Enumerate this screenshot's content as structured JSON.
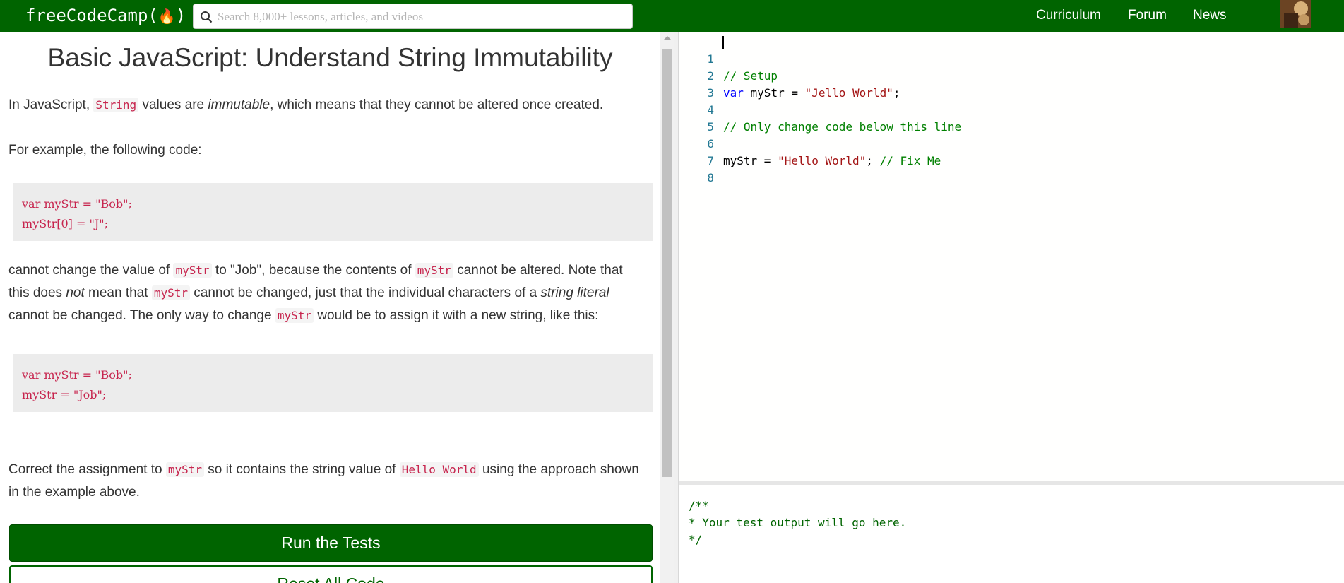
{
  "navbar": {
    "logo_text": "freeCodeCamp(",
    "logo_flame": "🔥",
    "logo_close": ")",
    "search_placeholder": "Search 8,000+ lessons, articles, and videos",
    "links": [
      "Curriculum",
      "Forum",
      "News"
    ]
  },
  "lesson": {
    "title": "Basic JavaScript: Understand String Immutability",
    "p1": {
      "a": "In JavaScript, ",
      "code": "String",
      "b": " values are ",
      "em": "immutable",
      "c": ", which means that they cannot be altered once created."
    },
    "p2": "For example, the following code:",
    "code_block_1": "var myStr = \"Bob\";\nmyStr[0] = \"J\";",
    "p3": {
      "a": "cannot change the value of ",
      "code1": "myStr",
      "b": " to \"Job\", because the contents of ",
      "code2": "myStr",
      "c": " cannot be altered. Note that this does ",
      "em1": "not",
      "d": " mean that ",
      "code3": "myStr",
      "e": " cannot be changed, just that the individual characters of a ",
      "em2": "string literal",
      "f": " cannot be changed. The only way to change ",
      "code4": "myStr",
      "g": " would be to assign it with a new string, like this:"
    },
    "code_block_2": "var myStr = \"Bob\";\nmyStr = \"Job\";",
    "p4": {
      "a": "Correct the assignment to ",
      "code1": "myStr",
      "b": " so it contains the string value of ",
      "code2": "Hello World",
      "c": " using the approach shown in the example above."
    },
    "run_button": "Run the Tests",
    "reset_button": "Reset All Code"
  },
  "editor": {
    "line_numbers": [
      "1",
      "2",
      "3",
      "4",
      "5",
      "6",
      "7",
      "8"
    ],
    "line1": "// Setup",
    "line2": {
      "kw": "var",
      "a": " myStr = ",
      "str": "\"Jello World\"",
      "b": ";"
    },
    "line4": "// Only change code below this line",
    "line6": {
      "a": "myStr = ",
      "str": "\"Hello World\"",
      "b": "; ",
      "comment": "// Fix Me"
    }
  },
  "output": {
    "text": "/**\n* Your test output will go here.\n*/"
  },
  "colors": {
    "navbar": "#006400",
    "inline_code": "#c7254e",
    "comment": "#008000",
    "keyword": "#0000ff",
    "string": "#a31515",
    "line_number": "#237893"
  }
}
